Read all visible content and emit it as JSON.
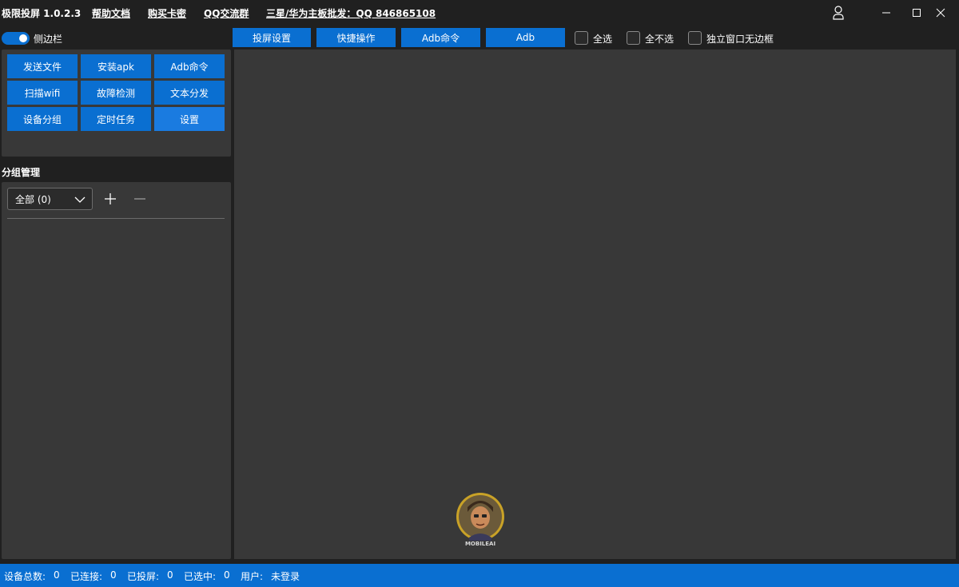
{
  "titlebar": {
    "app_title": "极限投屏 1.0.2.3",
    "help_docs": "帮助文档",
    "buy_card": "购买卡密",
    "qq_group": "QQ交流群",
    "wholesale": "三星/华为主板批发：QQ 846865108"
  },
  "sidebar": {
    "toggle_label": "侧边栏",
    "buttons": [
      "发送文件",
      "安装apk",
      "Adb命令",
      "扫描wifi",
      "故障检测",
      "文本分发",
      "设备分组",
      "定时任务",
      "设置"
    ],
    "group_title": "分组管理",
    "group_select": "全部 (0)"
  },
  "toolbar": {
    "tabs": [
      "投屏设置",
      "快捷操作",
      "Adb命令",
      "Adb"
    ],
    "checkboxes": [
      "全选",
      "全不选",
      "独立窗口无边框"
    ]
  },
  "logo": {
    "text": "MOBILEAI"
  },
  "status": {
    "total_label": "设备总数:",
    "total_value": "0",
    "connected_label": "已连接:",
    "connected_value": "0",
    "casting_label": "已投屏:",
    "casting_value": "0",
    "selected_label": "已选中:",
    "selected_value": "0",
    "user_label": "用户:",
    "user_value": "未登录"
  },
  "colors": {
    "accent": "#0a6fd1",
    "panel": "#383838",
    "background": "#202020"
  }
}
